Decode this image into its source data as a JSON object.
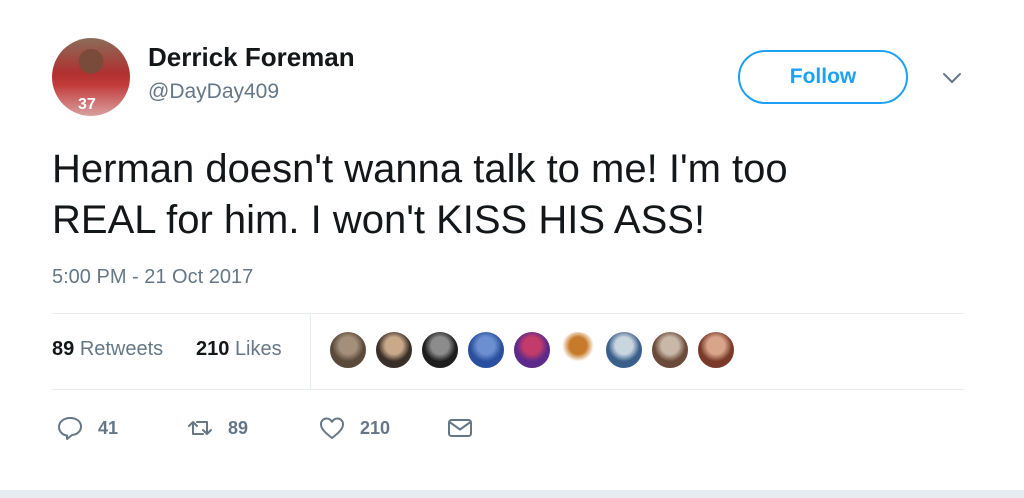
{
  "user": {
    "display_name": "Derrick Foreman",
    "screen_name": "@DayDay409",
    "avatar_jersey": "37"
  },
  "follow_button": {
    "label": "Follow"
  },
  "tweet": {
    "text_line1": "Herman doesn't wanna talk to me! I'm too",
    "text_line2": "REAL for him. I won't KISS HIS ASS!",
    "timestamp": "5:00 PM - 21 Oct 2017"
  },
  "stats": {
    "retweets_count": "89",
    "retweets_label": "Retweets",
    "likes_count": "210",
    "likes_label": "Likes"
  },
  "liker_avatars": [
    {
      "name": "liker-avatar-1",
      "colors": [
        "#5a4a3a",
        "#a38f7a"
      ]
    },
    {
      "name": "liker-avatar-2",
      "colors": [
        "#3a2f28",
        "#c9a98a"
      ]
    },
    {
      "name": "liker-avatar-3",
      "colors": [
        "#1e1e1e",
        "#8c8c8c"
      ]
    },
    {
      "name": "liker-avatar-4",
      "colors": [
        "#2a4f9e",
        "#6b8fd0"
      ]
    },
    {
      "name": "liker-avatar-5",
      "colors": [
        "#5b2a8a",
        "#c23b6a"
      ]
    },
    {
      "name": "liker-avatar-6",
      "colors": [
        "#ffffff",
        "#c77b2a"
      ]
    },
    {
      "name": "liker-avatar-7",
      "colors": [
        "#3a5f8a",
        "#c9d6e0"
      ]
    },
    {
      "name": "liker-avatar-8",
      "colors": [
        "#6a4a3a",
        "#c9b8a8"
      ]
    },
    {
      "name": "liker-avatar-9",
      "colors": [
        "#7a3a2a",
        "#d9a58a"
      ]
    }
  ],
  "actions": {
    "reply_count": "41",
    "retweet_count": "89",
    "like_count": "210"
  },
  "icons": {
    "reply": "reply-icon",
    "retweet": "retweet-icon",
    "like": "heart-icon",
    "dm": "envelope-icon",
    "caret": "chevron-down-icon"
  },
  "colors": {
    "accent": "#1da1f2",
    "secondary_text": "#657786",
    "primary_text": "#14171a",
    "divider": "#e6ecf0"
  }
}
